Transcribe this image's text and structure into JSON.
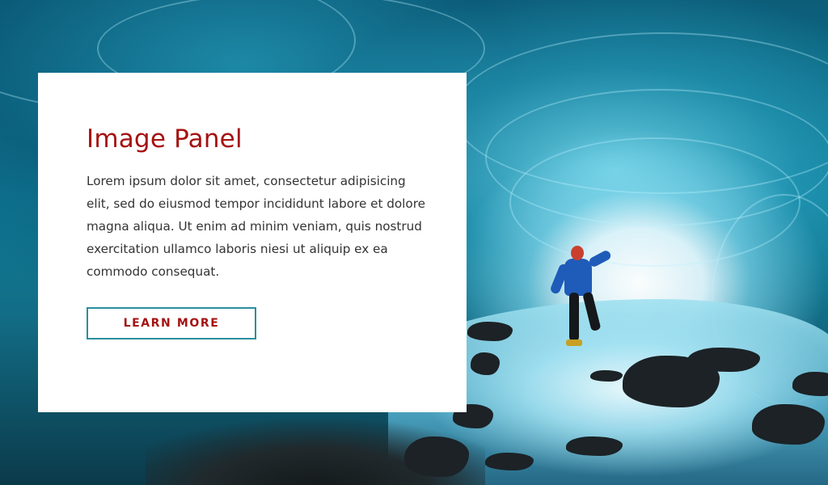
{
  "panel": {
    "title": "Image Panel",
    "body": "Lorem ipsum dolor sit amet, consectetur adipisicing elit, sed do eiusmod tempor incididunt labore et dolore magna aliqua. Ut enim ad minim veniam, quis nostrud exercitation ullamco laboris niesi ut aliquip ex ea commodo consequat.",
    "button_label": "LEARN MORE"
  },
  "background": {
    "description_icon": "ice-cave-photo"
  },
  "colors": {
    "title": "#a51212",
    "button_border": "#2a8f9e",
    "button_text": "#a51212",
    "body_text": "#333333"
  }
}
